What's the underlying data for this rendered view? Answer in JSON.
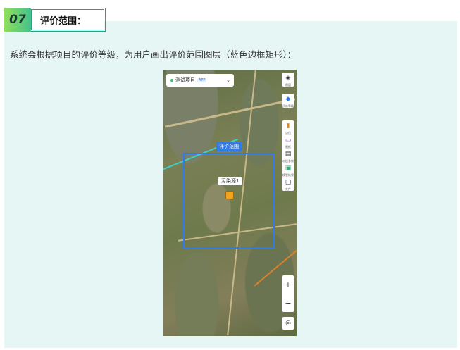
{
  "section": {
    "number": "07",
    "title": "评价范围："
  },
  "description": "系统会根据项目的评价等级，为用户画出评价范围图层（蓝色边框矩形）：",
  "app": {
    "project_selector": {
      "label": "测试项目",
      "tag": "APP"
    },
    "toolbar": [
      {
        "icon": "layers-icon",
        "label": "图层"
      },
      {
        "icon": "stack-icon",
        "label": "评价等级"
      }
    ],
    "toolbar2": [
      {
        "icon": "point-icon",
        "label": "点位"
      },
      {
        "icon": "rectangle-icon",
        "label": "画框"
      },
      {
        "icon": "document-icon",
        "label": "水质参数"
      },
      {
        "icon": "chart-icon",
        "label": "模型结果"
      },
      {
        "icon": "folder-icon",
        "label": "文件"
      }
    ],
    "range_label": "评价范围",
    "pollution_label": "污染源1",
    "zoom_in": "+",
    "zoom_out": "−",
    "locate_icon": "◎"
  },
  "colors": {
    "range_border": "#2f7be8",
    "badge_accent": "#43c18b"
  }
}
